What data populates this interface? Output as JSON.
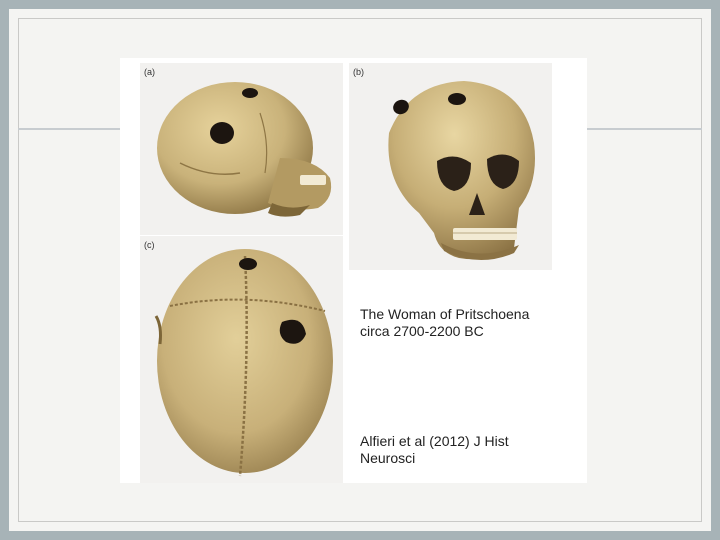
{
  "figure": {
    "panels": [
      {
        "label": "(a)",
        "view": "lateral skull view"
      },
      {
        "label": "(b)",
        "view": "anterolateral skull view"
      },
      {
        "label": "(c)",
        "view": "superior skull view"
      }
    ],
    "caption_title_line1": "The Woman of Pritschoena",
    "caption_title_line2": "circa 2700-2200 BC",
    "citation_line1": "Alfieri et al (2012) J Hist",
    "citation_line2": "Neurosci"
  },
  "colors": {
    "frame": "#a7b3b7",
    "slide": "#f4f4f2",
    "bone": "#c9b27a",
    "bone_dark": "#8e7645"
  }
}
